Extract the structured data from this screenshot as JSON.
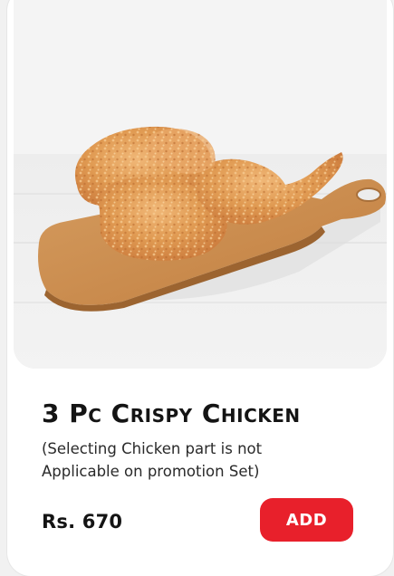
{
  "product": {
    "image_alt": "3 pieces of crispy fried chicken on a wooden cutting board",
    "title": "3 Pc Crispy Chicken",
    "description": "(Selecting Chicken part is not Applicable on promotion Set)",
    "price": "Rs. 670",
    "add_label": "ADD"
  },
  "colors": {
    "accent": "#e8202b",
    "text": "#141414",
    "card": "#ffffff"
  }
}
